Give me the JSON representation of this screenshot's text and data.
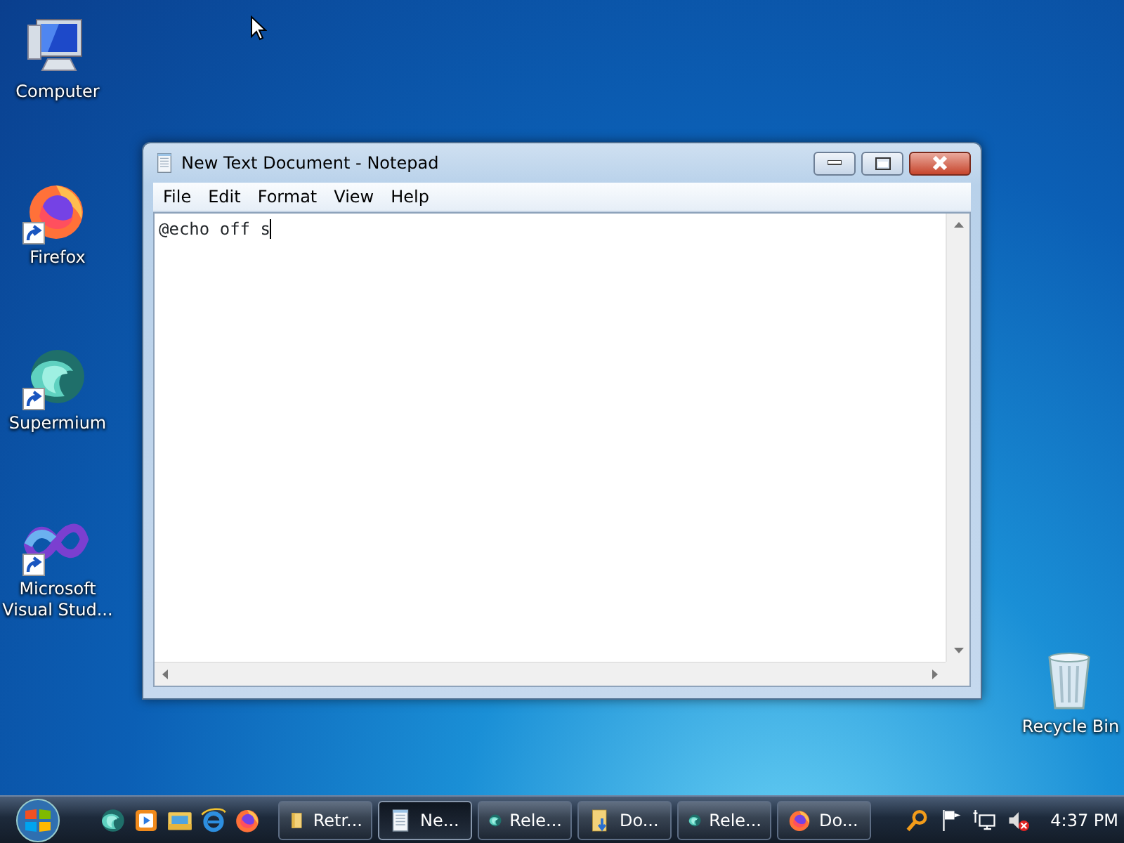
{
  "desktop_icons": [
    {
      "label": "Computer",
      "kind": "computer",
      "shortcut": false
    },
    {
      "label": "Firefox",
      "kind": "firefox",
      "shortcut": true
    },
    {
      "label": "Supermium",
      "kind": "supermium",
      "shortcut": true
    },
    {
      "label": "Microsoft Visual Stud...",
      "kind": "visualstudio",
      "shortcut": true
    },
    {
      "label": "Recycle Bin",
      "kind": "recyclebin",
      "shortcut": false
    }
  ],
  "window": {
    "title": "New Text Document - Notepad",
    "menu": [
      "File",
      "Edit",
      "Format",
      "View",
      "Help"
    ],
    "text": "@echo off s"
  },
  "taskbar": {
    "quick_launch": [
      {
        "kind": "supermium"
      },
      {
        "kind": "media"
      },
      {
        "kind": "explorer"
      },
      {
        "kind": "ie"
      },
      {
        "kind": "firefox"
      }
    ],
    "tasks": [
      {
        "label": "Retr...",
        "kind": "folder",
        "selected": false
      },
      {
        "label": "Ne...",
        "kind": "notepad",
        "selected": true
      },
      {
        "label": "Rele...",
        "kind": "supermium",
        "selected": false
      },
      {
        "label": "Do...",
        "kind": "download",
        "selected": false
      },
      {
        "label": "Rele...",
        "kind": "supermium",
        "selected": false
      },
      {
        "label": "Do...",
        "kind": "firefox",
        "selected": false
      }
    ],
    "tray": [
      {
        "kind": "search"
      },
      {
        "kind": "flag"
      },
      {
        "kind": "network"
      },
      {
        "kind": "volume-muted"
      }
    ],
    "clock": "4:37 PM"
  }
}
